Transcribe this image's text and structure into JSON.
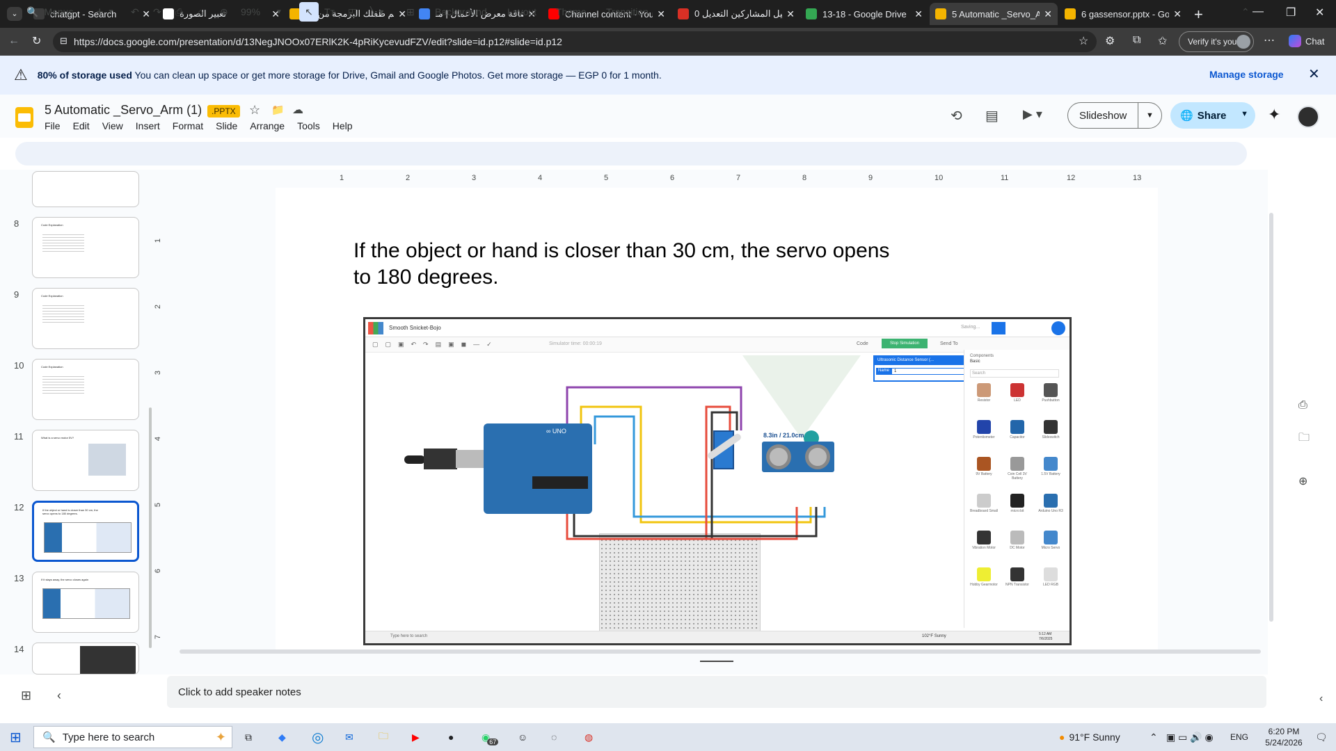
{
  "tabs": [
    {
      "label": "chatgpt - Search",
      "color": "#3c3c3c"
    },
    {
      "label": "تعبير الصورة",
      "color": "#ffffff"
    },
    {
      "label": "تعليم طفلك البرمجة من ال",
      "color": "#f4b400"
    },
    {
      "label": "إضافة معرض الأعمال | مـ",
      "color": "#4285f4"
    },
    {
      "label": "Channel content - YouTu",
      "color": "#ff0000"
    },
    {
      "label": "دليل المشاركين التعديل 0",
      "color": "#d93025"
    },
    {
      "label": "13-18 - Google Drive",
      "color": "#34a853"
    },
    {
      "label": "5 Automatic _Servo_Arm",
      "color": "#f4b400"
    },
    {
      "label": "6 gassensor.pptx - Goog",
      "color": "#f4b400"
    }
  ],
  "url": "https://docs.google.com/presentation/d/13NegJNOOx07ERlK2K-4pRiKycevudFZV/edit?slide=id.p12#slide=id.p12",
  "verify_label": "Verify it's you",
  "chat_label": "Chat",
  "banner": {
    "bold": "80% of storage used",
    "text": " You can clean up space or get more storage for Drive, Gmail and Google Photos. Get more storage — EGP 0 for 1 month.",
    "link": "Manage storage"
  },
  "doc": {
    "title": "5 Automatic _Servo_Arm (1)",
    "badge": ".PPTX",
    "menus": [
      "File",
      "Edit",
      "View",
      "Insert",
      "Format",
      "Slide",
      "Arrange",
      "Tools",
      "Help"
    ],
    "slideshow_label": "Slideshow",
    "share_label": "Share"
  },
  "toolbar": {
    "menus_label": "Menus",
    "zoom": "99%",
    "background": "Background",
    "layout": "Layout",
    "theme": "Theme",
    "transition": "Transition"
  },
  "ruler": [
    "1",
    "2",
    "3",
    "4",
    "5",
    "6",
    "7",
    "8",
    "9",
    "10",
    "11",
    "12",
    "13"
  ],
  "thumbnails": [
    {
      "num": "8",
      "title": "Code Explanation"
    },
    {
      "num": "9",
      "title": "Code Explanation"
    },
    {
      "num": "10",
      "title": "Code Explanation"
    },
    {
      "num": "11",
      "title": "What is a servo motor 5V?"
    },
    {
      "num": "12",
      "title": "If the object or hand is closer than 30 cm, the servo opens to 180 degrees."
    },
    {
      "num": "13",
      "title": "If it stays away, the servo closes again"
    },
    {
      "num": "14",
      "title": ""
    }
  ],
  "slide": {
    "text": "If the object or hand is closer than 30 cm, the servo opens to 180 degrees.",
    "sim": {
      "project": "Smooth Snicket-Bojo",
      "saving": "Saving...",
      "sim_time": "Simulator time: 00:00:19",
      "code": "Code",
      "stop": "Stop Simulation",
      "send": "Send To",
      "sensor_title": "Ultrasonic Distance Sensor (...",
      "name_label": "Name",
      "name_value": "1",
      "components": "Components",
      "basic": "Basic",
      "search": "Search",
      "distance": "8.3in / 21.0cm",
      "parts": [
        "Resistor",
        "LED",
        "Pushbutton",
        "Potentiometer",
        "Capacitor",
        "Slideswitch",
        "9V Battery",
        "Coin Cell 3V Battery",
        "1.5V Battery",
        "Breadboard Small",
        "micro:bit",
        "Arduino Uno R3",
        "Vibration Motor",
        "DC Motor",
        "Micro Servo",
        "Hobby Gearmotor",
        "NPN Transistor",
        "LED RGB"
      ],
      "win_search": "Type here to search",
      "win_weather": "102°F Sunny",
      "win_time": "5:12 AM",
      "win_date": "7/6/2025"
    }
  },
  "notes_placeholder": "Click to add speaker notes",
  "taskbar": {
    "search": "Type here to search",
    "weather": "91°F  Sunny",
    "lang": "ENG",
    "time": "6:20 PM",
    "date": "5/24/2026",
    "whatsapp_badge": "67"
  }
}
